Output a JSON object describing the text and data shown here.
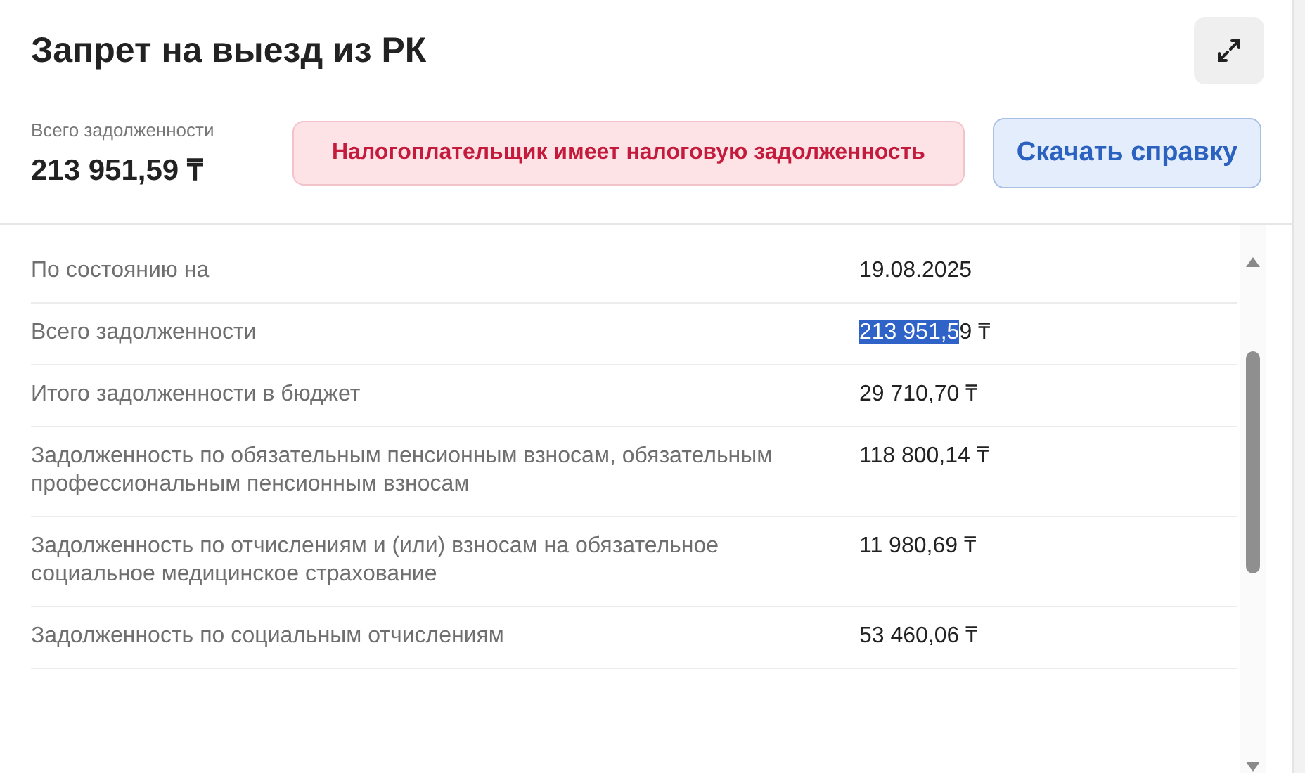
{
  "title": "Запрет на выезд из РК",
  "summary": {
    "label": "Всего задолженности",
    "amount": "213 951,59 ₸"
  },
  "alert": "Налогоплательщик имеет налоговую задолженность",
  "download_button": "Скачать справку",
  "rows": [
    {
      "label": "По состоянию на",
      "value": "19.08.2025"
    },
    {
      "label": "Всего задолженности",
      "value_selected": "213 951,5",
      "value": "9 ₸"
    },
    {
      "label": "Итого задолженности в бюджет",
      "value": "29 710,70 ₸"
    },
    {
      "label": "Задолженность по обязательным пенсионным взносам, обязательным профессиональным пенсионным взносам",
      "value": "118 800,14 ₸"
    },
    {
      "label": "Задолженность по отчислениям и (или) взносам на обязательное социальное медицинское страхование",
      "value": "11 980,69 ₸"
    },
    {
      "label": "Задолженность по социальным отчислениям",
      "value": "53 460,06 ₸"
    }
  ]
}
